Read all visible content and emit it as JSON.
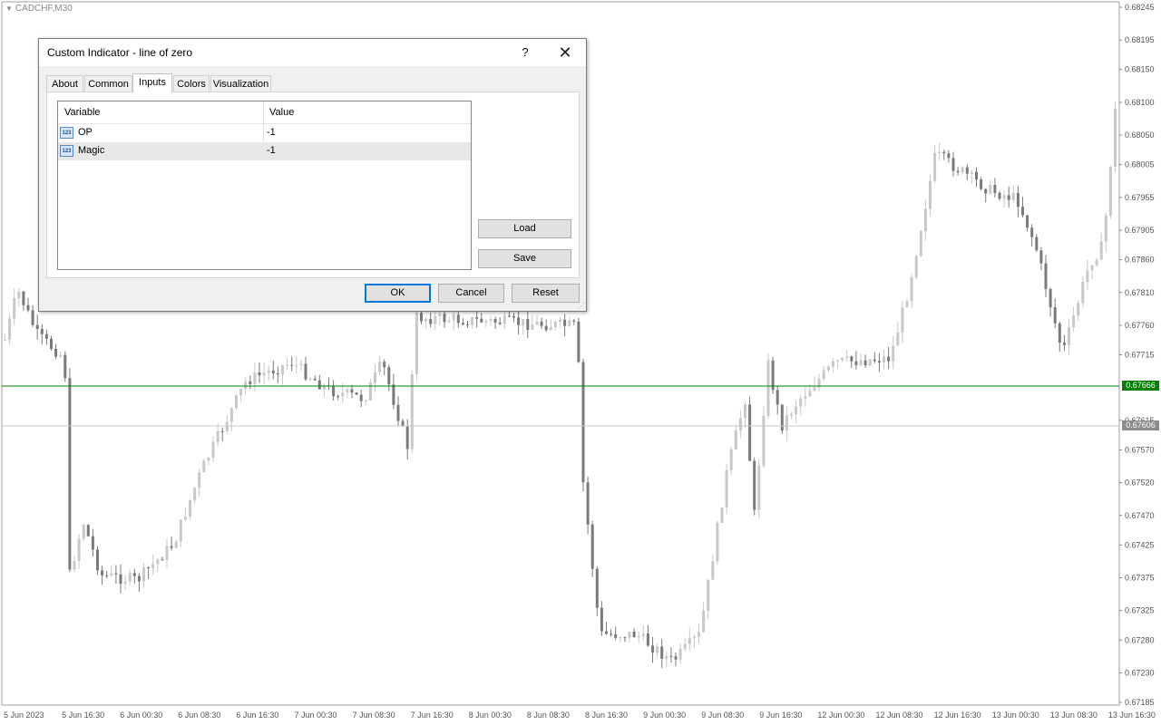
{
  "chart": {
    "symbol": "CADCHF,M30",
    "price_labels": [
      "0.68245",
      "0.68195",
      "0.68150",
      "0.68100",
      "0.68050",
      "0.68005",
      "0.67955",
      "0.67905",
      "0.67860",
      "0.67810",
      "0.67760",
      "0.67715",
      "0.67666",
      "0.67615",
      "0.67606",
      "0.67570",
      "0.67520",
      "0.67470",
      "0.67425",
      "0.67375",
      "0.67325",
      "0.67280",
      "0.67230",
      "0.67185"
    ],
    "time_labels": [
      "5 Jun 2023",
      "5 Jun 16:30",
      "6 Jun 00:30",
      "6 Jun 08:30",
      "6 Jun 16:30",
      "7 Jun 00:30",
      "7 Jun 08:30",
      "7 Jun 16:30",
      "8 Jun 00:30",
      "8 Jun 08:30",
      "8 Jun 16:30",
      "9 Jun 00:30",
      "9 Jun 08:30",
      "9 Jun 16:30",
      "12 Jun 00:30",
      "12 Jun 08:30",
      "12 Jun 16:30",
      "13 Jun 00:30",
      "13 Jun 08:30",
      "13 Jun 16:30"
    ],
    "zero_line_value": "0.67666",
    "bid_value": "0.67606",
    "zero_line_color": "#008000",
    "bid_line_color": "#c0c0c0"
  },
  "dialog": {
    "title": "Custom Indicator - line of zero",
    "help_label": "?",
    "close_label": "✕",
    "tabs": [
      {
        "label": "About"
      },
      {
        "label": "Common"
      },
      {
        "label": "Inputs",
        "active": true
      },
      {
        "label": "Colors"
      },
      {
        "label": "Visualization"
      }
    ],
    "grid": {
      "col_variable": "Variable",
      "col_value": "Value",
      "rows": [
        {
          "icon": "123",
          "name": "OP",
          "value": "-1"
        },
        {
          "icon": "123",
          "name": "Magic",
          "value": "-1"
        }
      ]
    },
    "load_label": "Load",
    "save_label": "Save",
    "ok_label": "OK",
    "cancel_label": "Cancel",
    "reset_label": "Reset"
  }
}
